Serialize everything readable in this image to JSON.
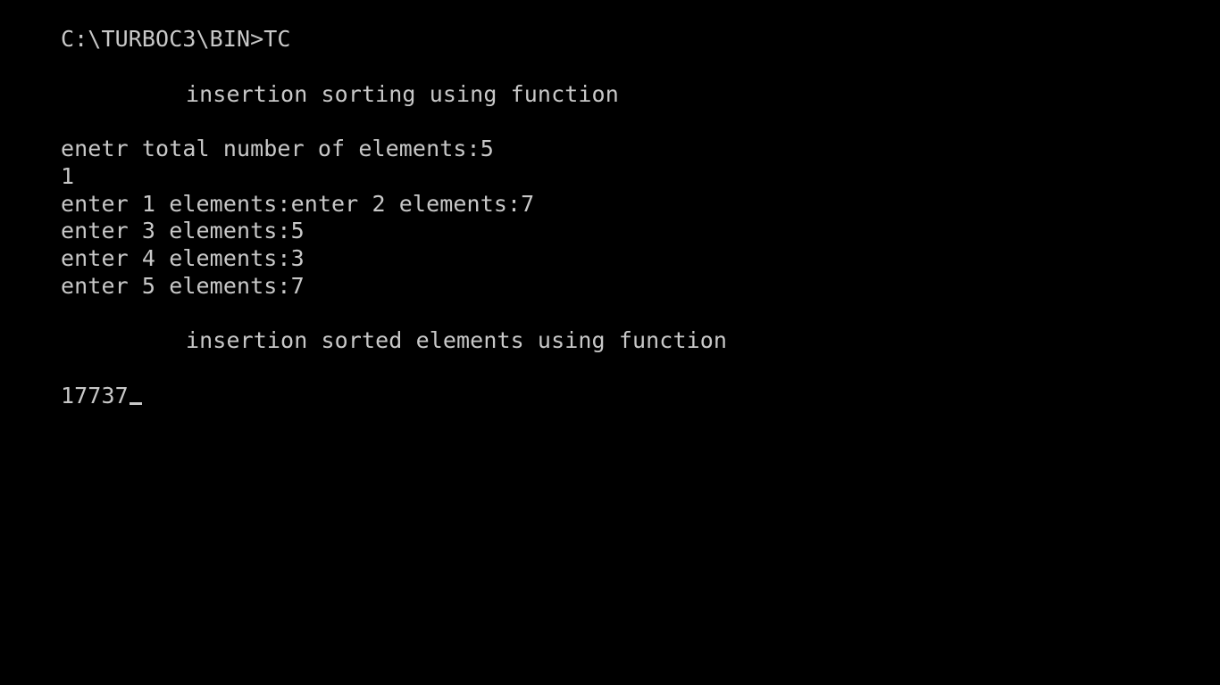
{
  "terminal": {
    "prompt_line": "C:\\TURBOC3\\BIN>TC",
    "title_line": "insertion sorting using function",
    "total_prompt": "enetr total number of elements:5",
    "input_echo": "1",
    "entry_lines": [
      "enter 1 elements:enter 2 elements:7",
      "enter 3 elements:5",
      "enter 4 elements:3",
      "enter 5 elements:7"
    ],
    "result_title": "insertion sorted elements using function",
    "result_values": "17737"
  }
}
